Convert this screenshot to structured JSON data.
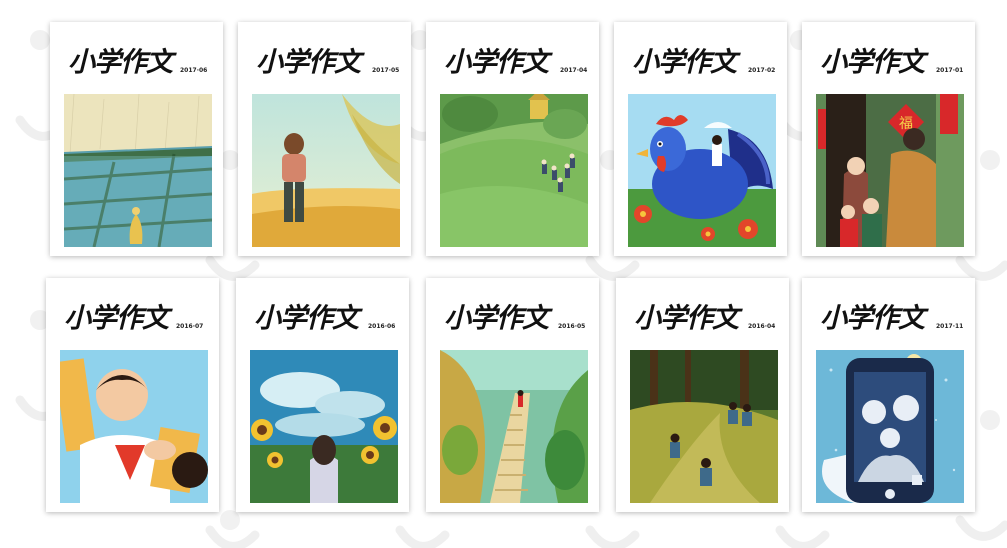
{
  "covers": [
    {
      "title": "小学作文",
      "issue": "2017·06"
    },
    {
      "title": "小学作文",
      "issue": "2017·05"
    },
    {
      "title": "小学作文",
      "issue": "2017·04"
    },
    {
      "title": "小学作文",
      "issue": "2017·02"
    },
    {
      "title": "小学作文",
      "issue": "2017·01"
    },
    {
      "title": "小学作文",
      "issue": "2016·07"
    },
    {
      "title": "小学作文",
      "issue": "2016·06"
    },
    {
      "title": "小学作文",
      "issue": "2016·05"
    },
    {
      "title": "小学作文",
      "issue": "2016·04"
    },
    {
      "title": "小学作文",
      "issue": "2017·11"
    }
  ],
  "colors": {
    "background": "#ffffff",
    "watermark": "#ededed"
  }
}
